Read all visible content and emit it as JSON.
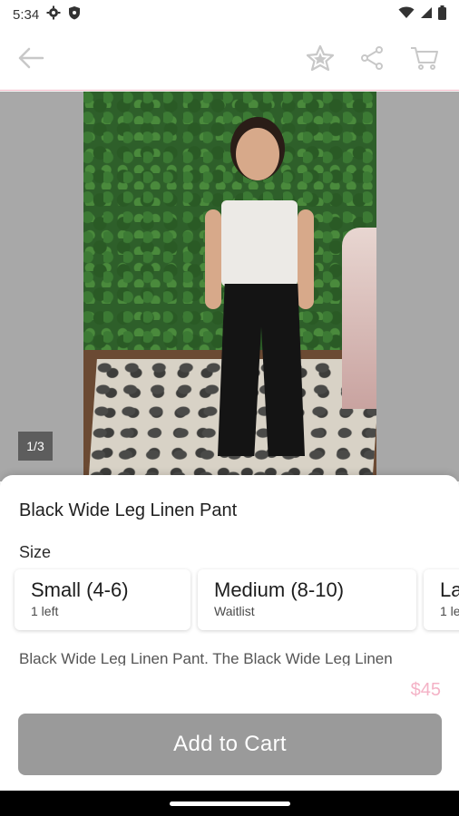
{
  "status_bar": {
    "time": "5:34",
    "icons": [
      "gear-icon",
      "shield-icon",
      "wifi-icon",
      "signal-icon",
      "battery-icon"
    ]
  },
  "toolbar": {
    "icons": [
      "back-arrow-icon",
      "star-icon",
      "share-icon",
      "cart-icon"
    ]
  },
  "gallery": {
    "counter": "1/3"
  },
  "product": {
    "title": "Black Wide Leg Linen Pant",
    "size_label": "Size",
    "sizes": [
      {
        "name": "Small (4-6)",
        "availability": "1 left"
      },
      {
        "name": "Medium (8-10)",
        "availability": "Waitlist"
      },
      {
        "name": "La",
        "availability": "1 le"
      }
    ],
    "description": "Black Wide Leg Linen Pant. The Black Wide Leg Linen",
    "price": "$45"
  },
  "actions": {
    "add_to_cart": "Add to Cart"
  },
  "colors": {
    "accent_pink": "#f4b2c6",
    "button_gray": "#9a9a9a"
  }
}
